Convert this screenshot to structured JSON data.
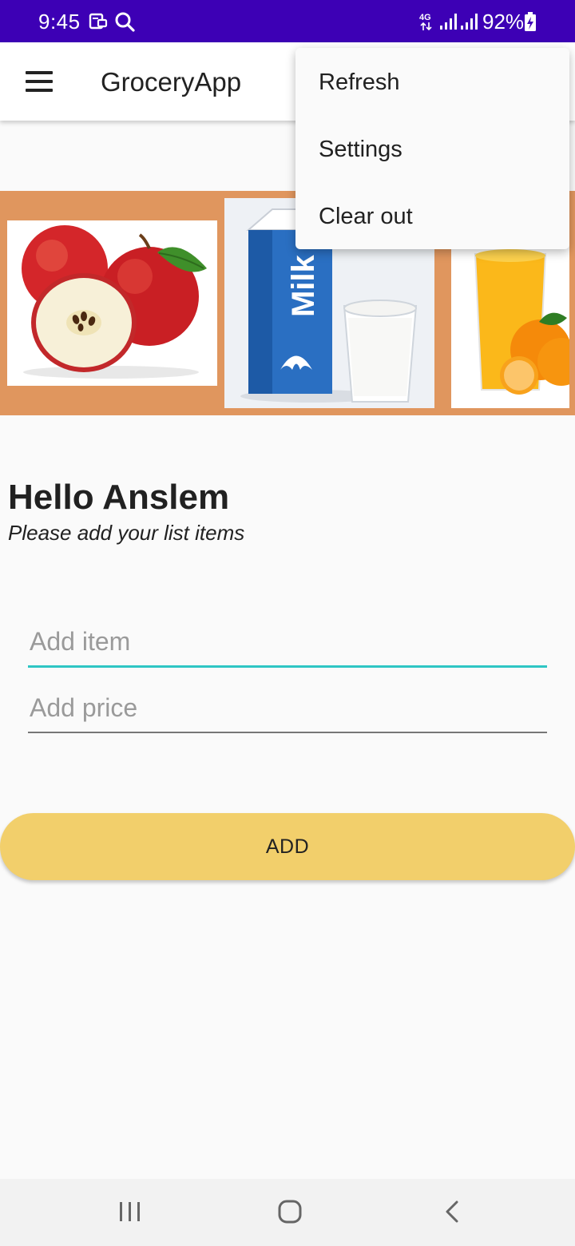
{
  "status_bar": {
    "time": "9:45",
    "battery_percent": "92%",
    "network_type": "4G",
    "icons": [
      "notification-icon",
      "search-icon",
      "network-4g-icon",
      "signal-icon",
      "signal-icon",
      "battery-charging-icon"
    ]
  },
  "app_bar": {
    "title": "GroceryApp",
    "menu_icon": "hamburger-menu-icon"
  },
  "banner": {
    "images": [
      "apples",
      "milk-carton-and-glass",
      "orange-juice-and-oranges"
    ]
  },
  "greeting": {
    "title": "Hello Anslem",
    "subtitle": "Please add your list items"
  },
  "form": {
    "item_placeholder": "Add item",
    "item_value": "",
    "price_placeholder": "Add price",
    "price_value": "",
    "add_label": "ADD"
  },
  "overflow_menu": {
    "items": [
      {
        "label": "Refresh"
      },
      {
        "label": "Settings"
      },
      {
        "label": "Clear out"
      }
    ]
  },
  "nav_bar": {
    "icons": [
      "recents-icon",
      "home-icon",
      "back-icon"
    ]
  },
  "colors": {
    "status_bar": "#3d00b5",
    "banner": "#e0965e",
    "accent": "#2ec6c4",
    "add_button": "#f2cf6b"
  }
}
